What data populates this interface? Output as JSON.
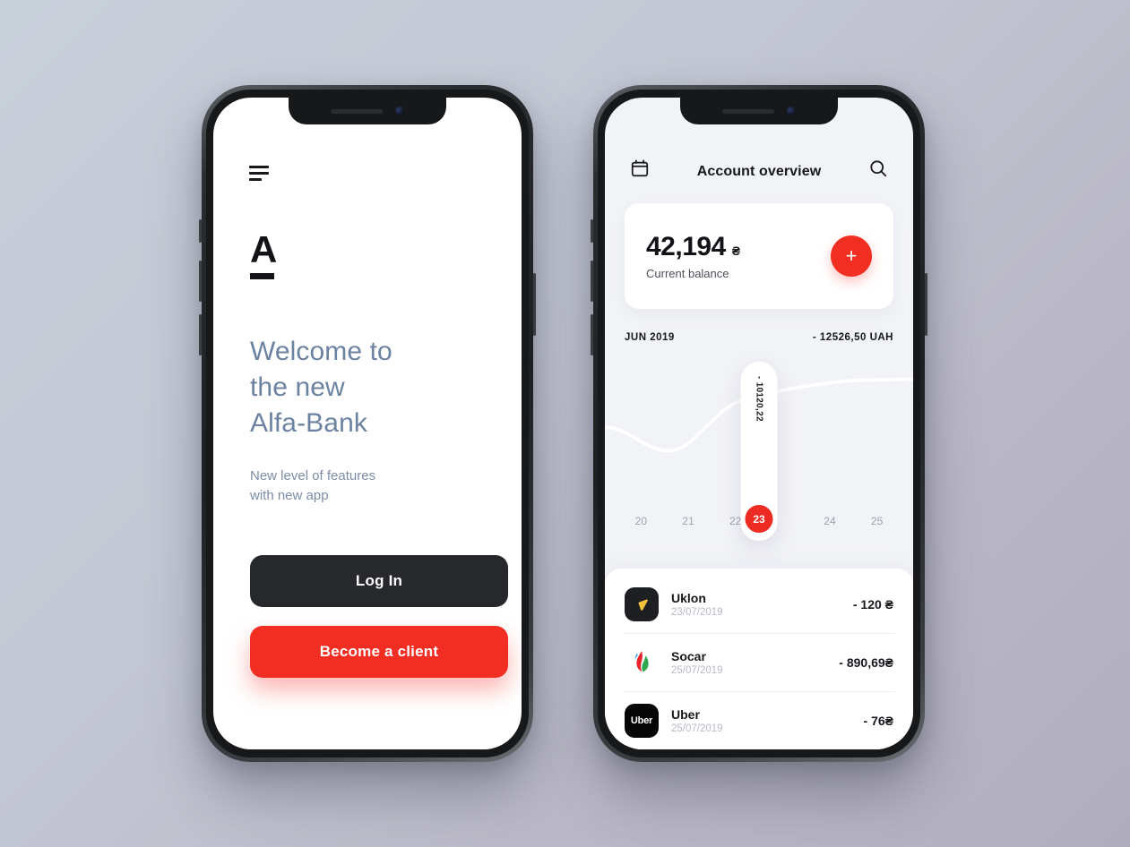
{
  "background": {
    "from": "#c8d0da",
    "to": "#b0aebd"
  },
  "accent": {
    "red": "#f22d22",
    "dark": "#26282c",
    "heading_blue": "#6c82a1"
  },
  "welcome_screen": {
    "menu_icon": "hamburger-icon",
    "logo_letter": "A",
    "title": "Welcome to\nthe new\nAlfa-Bank",
    "title_lines": [
      "Welcome to",
      "the new",
      "Alfa-Bank"
    ],
    "subtitle_lines": [
      "New level of features",
      "with new app"
    ],
    "login_label": "Log In",
    "become_client_label": "Become a client"
  },
  "account_screen": {
    "header": {
      "calendar_icon": "calendar-icon",
      "title": "Account overview",
      "search_icon": "search-icon"
    },
    "balance_card": {
      "amount": "42,194",
      "currency": "₴",
      "label": "Current balance",
      "add_label": "+"
    },
    "chart_header": {
      "period": "JUN 2019",
      "total": "- 12526,50 UAH"
    },
    "tooltip": {
      "value": "- 10120,22",
      "day": "23"
    },
    "transactions": [
      {
        "icon": "uklon-icon",
        "name": "Uklon",
        "date": "23/07/2019",
        "amount": "- 120 ₴"
      },
      {
        "icon": "socar-icon",
        "name": "Socar",
        "date": "25/07/2019",
        "amount": "- 890,69₴"
      },
      {
        "icon": "uber-icon",
        "name": "Uber",
        "date": "25/07/2019",
        "amount": "- 76₴",
        "icon_text": "Uber"
      }
    ]
  },
  "chart_data": {
    "type": "line",
    "title": "JUN 2019",
    "subtitle": "- 12526,50 UAH",
    "xlabel": "",
    "ylabel": "",
    "categories": [
      "20",
      "21",
      "22",
      "23",
      "24",
      "25"
    ],
    "x": [
      20,
      21,
      22,
      23,
      24,
      25
    ],
    "values": [
      -9200,
      -10600,
      -10400,
      -10120.22,
      -9000,
      -8900
    ],
    "highlight_index": 3,
    "highlight_label": "- 10120,22",
    "line_color": "#ffffff",
    "grid": false,
    "legend": false,
    "series": [
      {
        "name": "Balance",
        "values": [
          -9200,
          -10600,
          -10400,
          -10120.22,
          -9000,
          -8900
        ]
      }
    ]
  }
}
